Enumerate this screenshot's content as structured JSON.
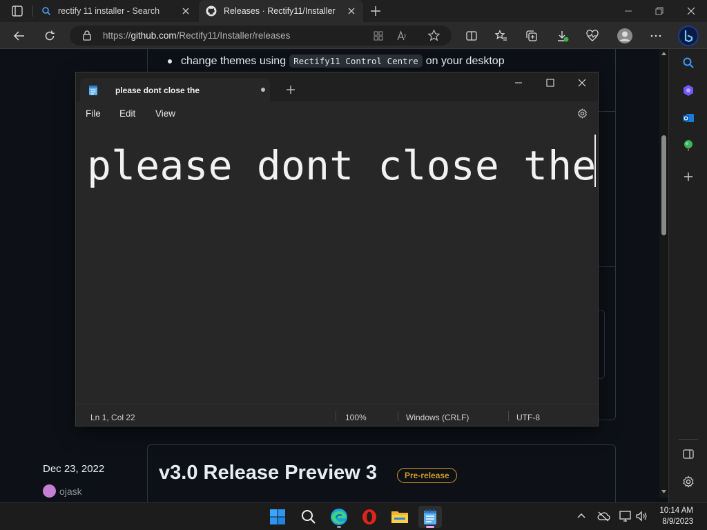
{
  "browser": {
    "tabs": [
      {
        "title": "rectify 11 installer - Search",
        "icon": "search-icon"
      },
      {
        "title": "Releases · Rectify11/Installer",
        "icon": "github-icon"
      }
    ],
    "url": {
      "prefix": "https://",
      "host": "github.com",
      "path": "/Rectify11/Installer/releases"
    }
  },
  "page": {
    "bullet": {
      "before": "change themes using",
      "code": "Rectify11 Control Centre",
      "after": "on your desktop"
    },
    "release": {
      "date": "Dec 23, 2022",
      "author": "ojask",
      "title": "v3.0 Release Preview 3",
      "badge": "Pre-release"
    }
  },
  "notepad": {
    "tab_title": "please dont close the",
    "menu": [
      "File",
      "Edit",
      "View"
    ],
    "content": "please dont close the",
    "status": {
      "position": "Ln 1, Col 22",
      "zoom": "100%",
      "line_ending": "Windows (CRLF)",
      "encoding": "UTF-8"
    }
  },
  "taskbar": {
    "apps": [
      "start-icon",
      "search-icon",
      "edge-icon",
      "opera-icon",
      "file-explorer-icon",
      "notepad-icon"
    ],
    "time": "10:14 AM",
    "date": "8/9/2023"
  },
  "colors": {
    "accent": "#0078d4",
    "badge": "#d29922",
    "page_bg": "#0d1117"
  }
}
